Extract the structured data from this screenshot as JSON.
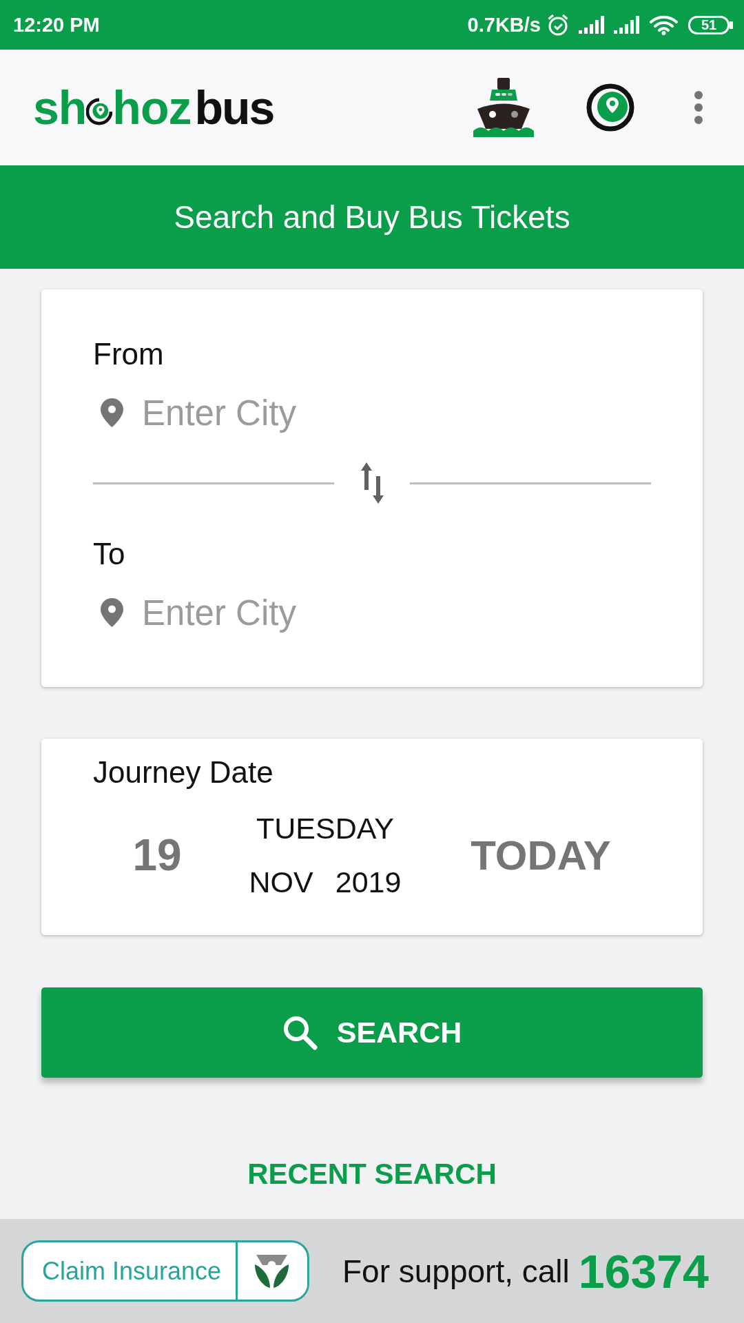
{
  "status_bar": {
    "time": "12:20 PM",
    "network_speed": "0.7KB/s",
    "battery": "51"
  },
  "app_bar": {
    "logo": {
      "lead": "sh",
      "middle": "hoz",
      "tail": "bus"
    }
  },
  "banner": {
    "title": "Search and Buy Bus Tickets"
  },
  "route_card": {
    "fields": [
      {
        "label": "From",
        "placeholder": "Enter City"
      },
      {
        "label": "To",
        "placeholder": "Enter City"
      }
    ]
  },
  "date_card": {
    "label": "Journey Date",
    "day": "19",
    "weekday": "TUESDAY",
    "month": "NOV",
    "year": "2019",
    "relative_day": "TODAY"
  },
  "search_button": {
    "label": "SEARCH"
  },
  "recent_search": {
    "label": "RECENT SEARCH"
  },
  "footer": {
    "insurance_button": {
      "label": "Claim Insurance"
    },
    "support_text": "For support, call",
    "support_number": "16374"
  }
}
